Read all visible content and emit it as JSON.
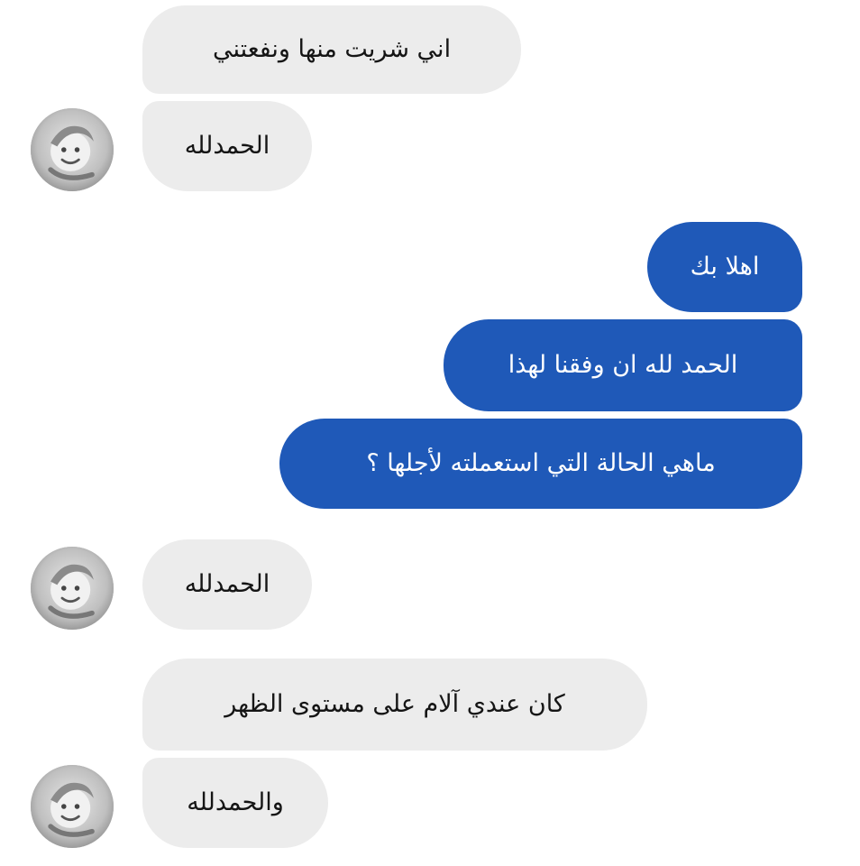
{
  "conversation": {
    "messages": [
      {
        "sender": "incoming",
        "text": "اني شريت منها ونفعتني"
      },
      {
        "sender": "incoming",
        "text": "الحمدلله"
      },
      {
        "sender": "outgoing",
        "text": "اهلا بك"
      },
      {
        "sender": "outgoing",
        "text": "الحمد لله ان وفقنا لهذا"
      },
      {
        "sender": "outgoing",
        "text": "ماهي الحالة التي استعملته لأجلها ؟"
      },
      {
        "sender": "incoming",
        "text": "الحمدلله"
      },
      {
        "sender": "incoming",
        "text": "كان عندي آلام على مستوى  الظهر"
      },
      {
        "sender": "incoming",
        "text": "والحمدلله"
      }
    ]
  },
  "colors": {
    "outgoing_bubble": "#1f59b8",
    "incoming_bubble": "#ececec",
    "background": "#ffffff"
  },
  "icons": {
    "avatar": "contact-avatar-photo"
  }
}
